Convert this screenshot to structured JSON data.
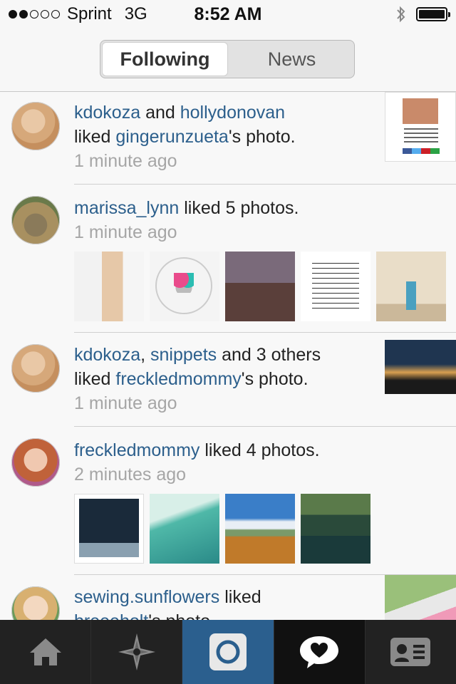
{
  "status_bar": {
    "carrier": "Sprint",
    "network": "3G",
    "time": "8:52 AM",
    "signal_bars_filled": 2,
    "signal_bars_total": 5,
    "battery_level": 0.95
  },
  "header": {
    "tabs": [
      {
        "label": "Following",
        "active": true
      },
      {
        "label": "News",
        "active": false
      }
    ]
  },
  "feed": {
    "items": [
      {
        "users": [
          "kdokoza",
          "hollydonovan"
        ],
        "text_and": "and",
        "text_liked": "liked",
        "target": "gingerunzueta",
        "text_suffix": "'s photo.",
        "time": "1 minute ago"
      },
      {
        "user": "marissa_lynn",
        "text_liked": "liked 5 photos.",
        "time": "1 minute ago"
      },
      {
        "users": [
          "kdokoza",
          "snippets"
        ],
        "text_others": "and 3 others",
        "text_liked": "liked",
        "target": "freckledmommy",
        "text_suffix": "'s photo.",
        "time": "1 minute ago"
      },
      {
        "user": "freckledmommy",
        "text_liked": "liked 4 photos.",
        "time": "2 minutes ago"
      },
      {
        "user": "sewing.sunflowers",
        "text_liked": "liked",
        "target": "breeeholt",
        "text_suffix": "'s photo."
      }
    ]
  },
  "tabbar": {
    "icons": [
      "home-icon",
      "explore-icon",
      "camera-icon",
      "activity-icon",
      "profile-icon"
    ],
    "active_index": 2,
    "active_color": "#2b5f8e"
  },
  "colors": {
    "username": "#2c5f8c",
    "timestamp": "#a6a6a6"
  }
}
